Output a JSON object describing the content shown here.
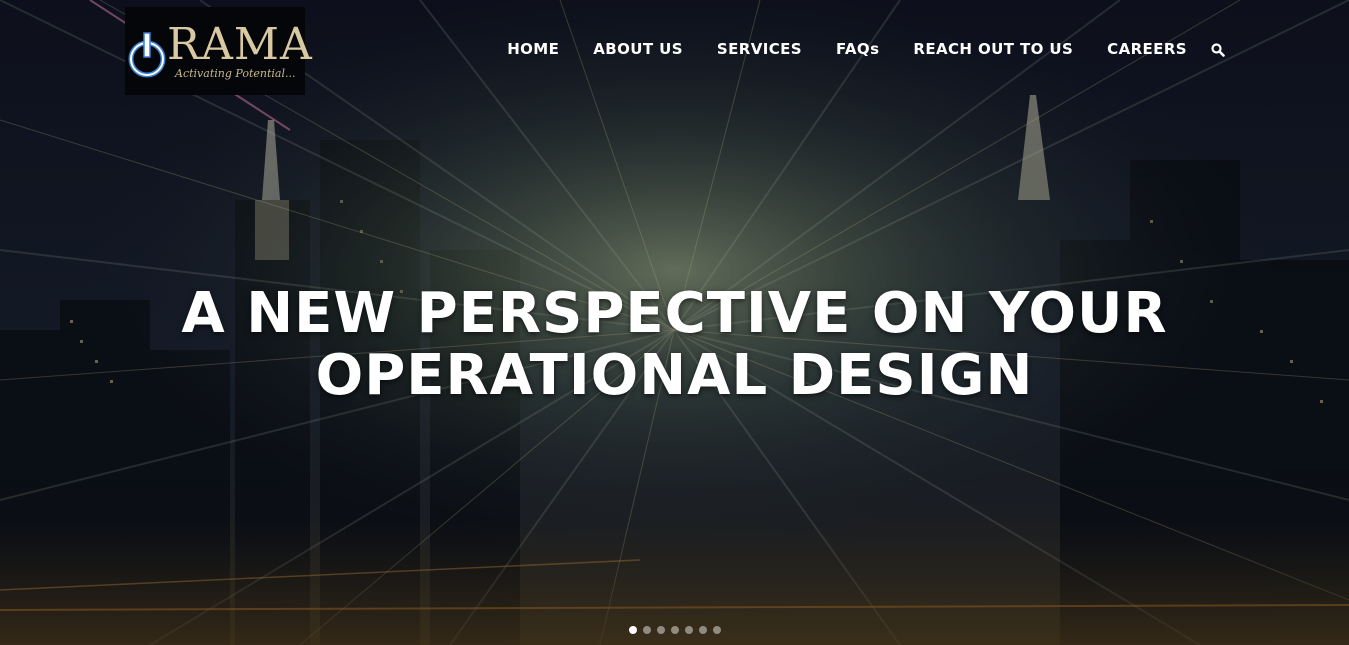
{
  "brand": {
    "name": "RAMA",
    "tagline": "Activating Potential..."
  },
  "nav": {
    "items": [
      {
        "label": "HOME"
      },
      {
        "label": "ABOUT US"
      },
      {
        "label": "SERVICES"
      },
      {
        "label": "FAQs"
      },
      {
        "label": "REACH OUT TO US"
      },
      {
        "label": "CAREERS"
      }
    ],
    "search_icon": "search-icon"
  },
  "hero": {
    "headline_line1": "A NEW PERSPECTIVE ON YOUR",
    "headline_line2": "OPERATIONAL DESIGN"
  },
  "slider": {
    "slide_count": 7,
    "active_index": 0
  },
  "colors": {
    "nav_text": "#ffffff",
    "logo_gold": "#d9c9a3",
    "logo_ring": "#3a7fd0"
  }
}
